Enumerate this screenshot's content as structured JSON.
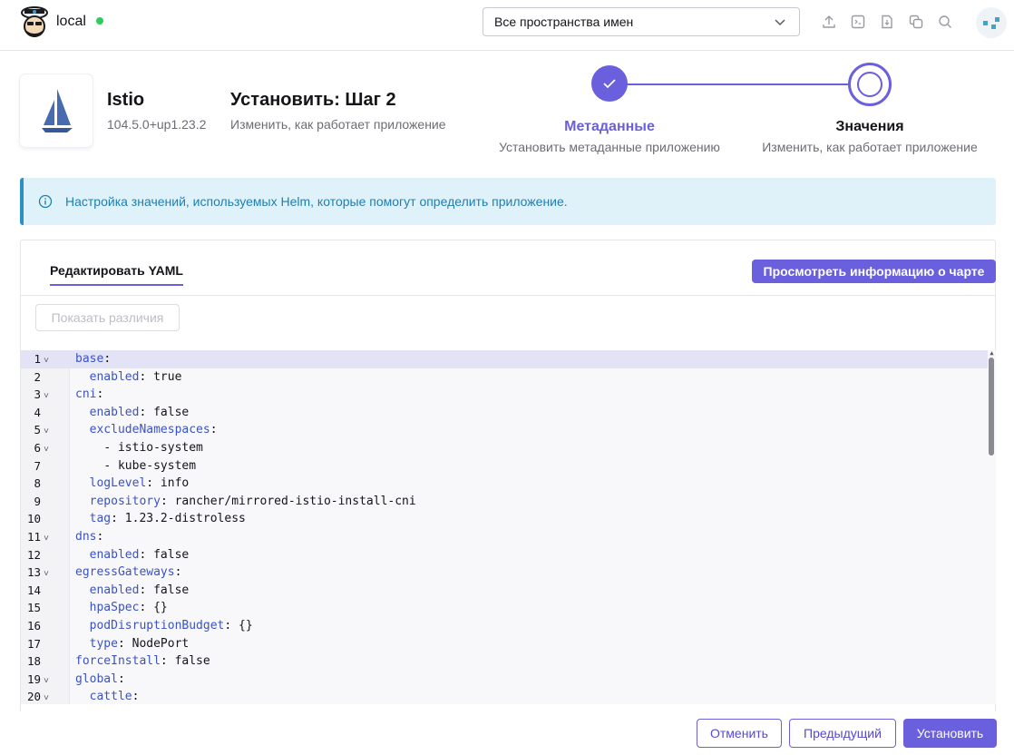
{
  "header": {
    "cluster_name": "local",
    "namespace_select": "Все пространства имен",
    "icons": [
      "upload-icon",
      "terminal-icon",
      "download-icon",
      "copy-icon",
      "search-icon"
    ],
    "status_color": "#2ecc5c"
  },
  "app": {
    "name": "Istio",
    "version": "104.5.0+up1.23.2",
    "step_title": "Установить: Шаг 2",
    "step_subtitle": "Изменить, как работает приложение"
  },
  "stepper": {
    "steps": [
      {
        "label": "Метаданные",
        "subtitle": "Установить метаданные приложению",
        "state": "done"
      },
      {
        "label": "Значения",
        "subtitle": "Изменить, как работает приложение",
        "state": "current"
      }
    ],
    "accent": "#6a5fdd"
  },
  "banner": {
    "text": "Настройка значений, используемых Helm, которые помогут определить приложение."
  },
  "panel": {
    "tab_label": "Редактировать YAML",
    "chart_info_button": "Просмотреть информацию о чарте",
    "diff_button": "Показать различия"
  },
  "editor": {
    "lines": [
      {
        "n": "1",
        "fold": true,
        "indent": "",
        "key": "base",
        "val": ""
      },
      {
        "n": "2",
        "fold": false,
        "indent": "  ",
        "key": "enabled",
        "val": " true"
      },
      {
        "n": "3",
        "fold": true,
        "indent": "",
        "key": "cni",
        "val": ""
      },
      {
        "n": "4",
        "fold": false,
        "indent": "  ",
        "key": "enabled",
        "val": " false"
      },
      {
        "n": "5",
        "fold": true,
        "indent": "  ",
        "key": "excludeNamespaces",
        "val": ""
      },
      {
        "n": "6",
        "fold": true,
        "indent": "    ",
        "key": "",
        "val": "- istio-system"
      },
      {
        "n": "7",
        "fold": false,
        "indent": "    ",
        "key": "",
        "val": "- kube-system"
      },
      {
        "n": "8",
        "fold": false,
        "indent": "  ",
        "key": "logLevel",
        "val": " info"
      },
      {
        "n": "9",
        "fold": false,
        "indent": "  ",
        "key": "repository",
        "val": " rancher/mirrored-istio-install-cni"
      },
      {
        "n": "10",
        "fold": false,
        "indent": "  ",
        "key": "tag",
        "val": " 1.23.2-distroless"
      },
      {
        "n": "11",
        "fold": true,
        "indent": "",
        "key": "dns",
        "val": ""
      },
      {
        "n": "12",
        "fold": false,
        "indent": "  ",
        "key": "enabled",
        "val": " false"
      },
      {
        "n": "13",
        "fold": true,
        "indent": "",
        "key": "egressGateways",
        "val": ""
      },
      {
        "n": "14",
        "fold": false,
        "indent": "  ",
        "key": "enabled",
        "val": " false"
      },
      {
        "n": "15",
        "fold": false,
        "indent": "  ",
        "key": "hpaSpec",
        "val": " {}"
      },
      {
        "n": "16",
        "fold": false,
        "indent": "  ",
        "key": "podDisruptionBudget",
        "val": " {}"
      },
      {
        "n": "17",
        "fold": false,
        "indent": "  ",
        "key": "type",
        "val": " NodePort"
      },
      {
        "n": "18",
        "fold": false,
        "indent": "",
        "key": "forceInstall",
        "val": " false"
      },
      {
        "n": "19",
        "fold": true,
        "indent": "",
        "key": "global",
        "val": ""
      },
      {
        "n": "20",
        "fold": true,
        "indent": "  ",
        "key": "cattle",
        "val": ""
      }
    ]
  },
  "footer": {
    "cancel": "Отменить",
    "previous": "Предыдущий",
    "install": "Установить"
  }
}
